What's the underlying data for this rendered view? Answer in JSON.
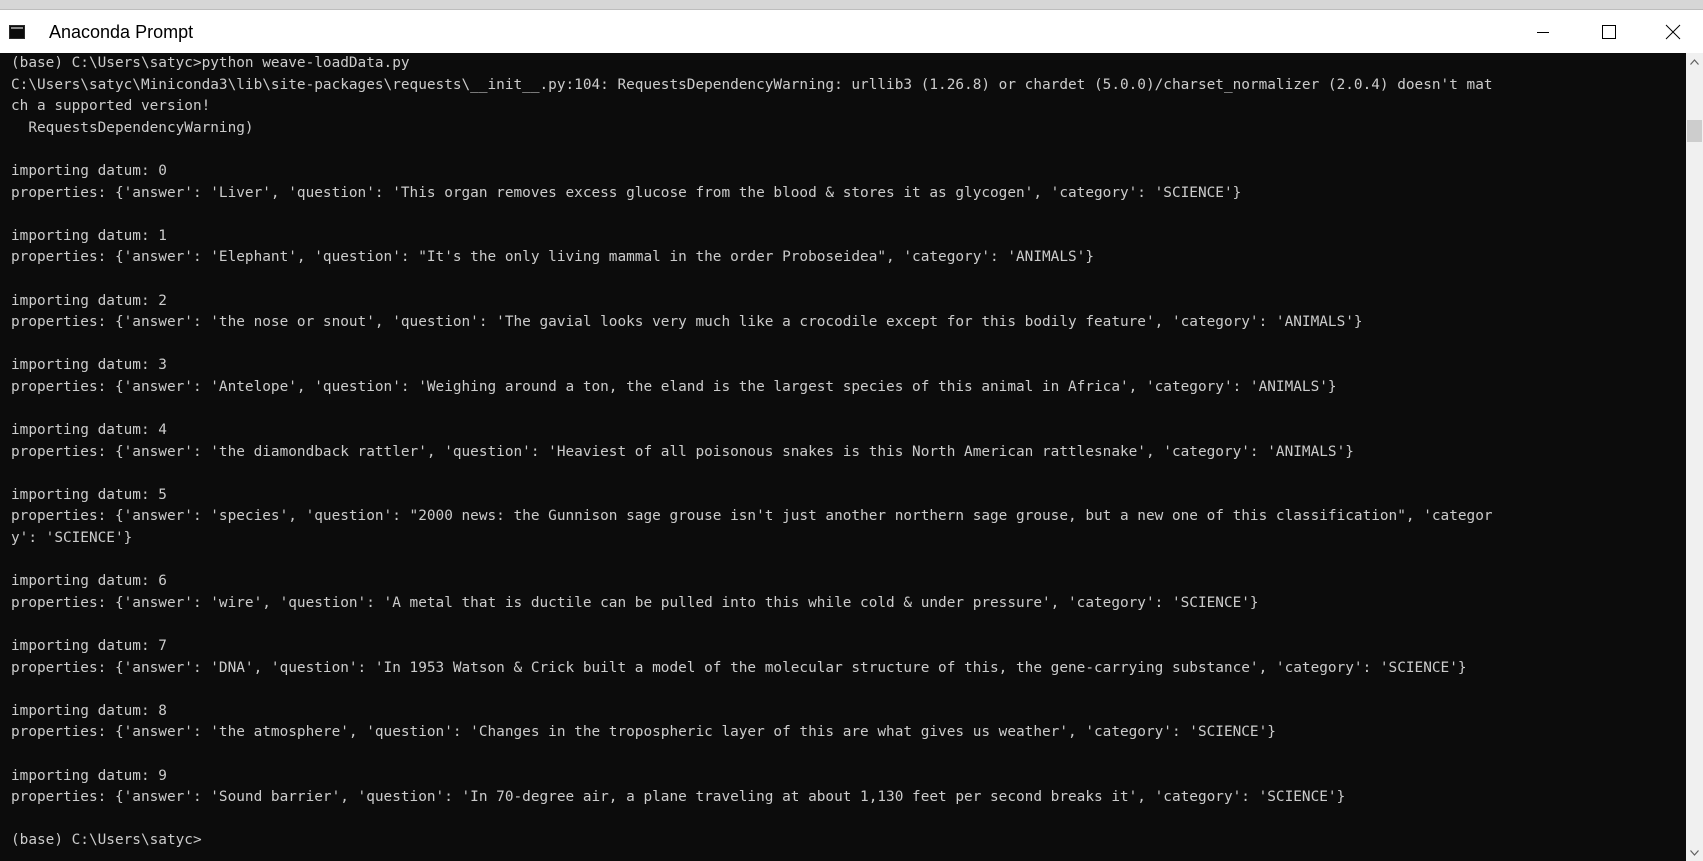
{
  "window": {
    "title": "Anaconda Prompt",
    "icon": "console-icon",
    "controls": [
      "minimize-icon",
      "maximize-icon",
      "close-icon"
    ]
  },
  "terminal": {
    "lines": [
      "(base) C:\\Users\\satyc>python weave-loadData.py",
      "C:\\Users\\satyc\\Miniconda3\\lib\\site-packages\\requests\\__init__.py:104: RequestsDependencyWarning: urllib3 (1.26.8) or chardet (5.0.0)/charset_normalizer (2.0.4) doesn't mat",
      "ch a supported version!",
      "  RequestsDependencyWarning)",
      "",
      "importing datum: 0",
      "properties: {'answer': 'Liver', 'question': 'This organ removes excess glucose from the blood & stores it as glycogen', 'category': 'SCIENCE'}",
      "",
      "importing datum: 1",
      "properties: {'answer': 'Elephant', 'question': \"It's the only living mammal in the order Proboseidea\", 'category': 'ANIMALS'}",
      "",
      "importing datum: 2",
      "properties: {'answer': 'the nose or snout', 'question': 'The gavial looks very much like a crocodile except for this bodily feature', 'category': 'ANIMALS'}",
      "",
      "importing datum: 3",
      "properties: {'answer': 'Antelope', 'question': 'Weighing around a ton, the eland is the largest species of this animal in Africa', 'category': 'ANIMALS'}",
      "",
      "importing datum: 4",
      "properties: {'answer': 'the diamondback rattler', 'question': 'Heaviest of all poisonous snakes is this North American rattlesnake', 'category': 'ANIMALS'}",
      "",
      "importing datum: 5",
      "properties: {'answer': 'species', 'question': \"2000 news: the Gunnison sage grouse isn't just another northern sage grouse, but a new one of this classification\", 'categor",
      "y': 'SCIENCE'}",
      "",
      "importing datum: 6",
      "properties: {'answer': 'wire', 'question': 'A metal that is ductile can be pulled into this while cold & under pressure', 'category': 'SCIENCE'}",
      "",
      "importing datum: 7",
      "properties: {'answer': 'DNA', 'question': 'In 1953 Watson & Crick built a model of the molecular structure of this, the gene-carrying substance', 'category': 'SCIENCE'}",
      "",
      "importing datum: 8",
      "properties: {'answer': 'the atmosphere', 'question': 'Changes in the tropospheric layer of this are what gives us weather', 'category': 'SCIENCE'}",
      "",
      "importing datum: 9",
      "properties: {'answer': 'Sound barrier', 'question': 'In 70-degree air, a plane traveling at about 1,130 feet per second breaks it', 'category': 'SCIENCE'}",
      "",
      "(base) C:\\Users\\satyc>"
    ]
  },
  "colors": {
    "terminal_background": "#0c0c0c",
    "terminal_text": "#cccccc",
    "titlebar_background": "#ffffff"
  }
}
